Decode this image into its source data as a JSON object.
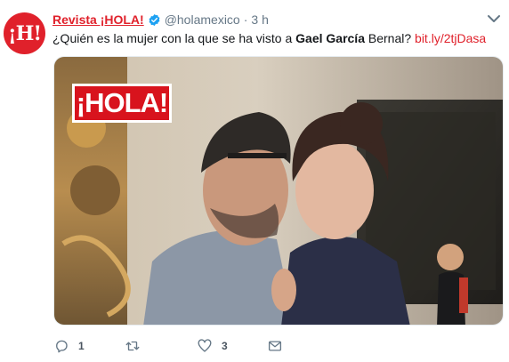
{
  "tweet": {
    "avatar_text": "¡H!",
    "display_name": "Revista ¡HOLA!",
    "handle": "@holamexico",
    "separator": "·",
    "time": "3 h",
    "text_before": "¿Quién es la mujer con la que se ha visto a ",
    "text_bold": "Gael García",
    "text_after": " Bernal? ",
    "link": "bit.ly/2tjDasa",
    "media_badge": "¡HOLA!"
  },
  "actions": {
    "reply_count": "1",
    "retweet_count": "",
    "like_count": "3"
  },
  "icons": {
    "verified": "verified-badge-icon",
    "caret": "chevron-down-icon",
    "reply": "reply-icon",
    "retweet": "retweet-icon",
    "like": "heart-icon",
    "dm": "envelope-icon"
  },
  "colors": {
    "brand": "#e0212b",
    "verified": "#1da1f2",
    "muted": "#657786"
  }
}
